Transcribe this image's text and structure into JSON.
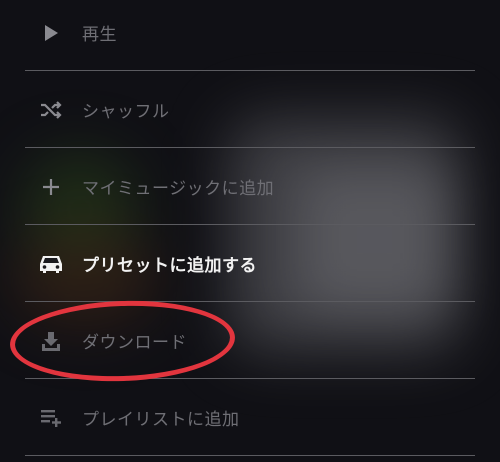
{
  "menu": {
    "items": [
      {
        "label": "再生",
        "icon": "play-icon",
        "state": "dim"
      },
      {
        "label": "シャッフル",
        "icon": "shuffle-icon",
        "state": "dim"
      },
      {
        "label": "マイミュージックに追加",
        "icon": "plus-icon",
        "state": "dim"
      },
      {
        "label": "プリセットに追加する",
        "icon": "car-icon",
        "state": "bright"
      },
      {
        "label": "ダウンロード",
        "icon": "download-icon",
        "state": "dim"
      },
      {
        "label": "プレイリストに追加",
        "icon": "playlist-add-icon",
        "state": "dim"
      }
    ]
  },
  "colors": {
    "dim_text": "#6f6f75",
    "bright_text": "#f2f2f2",
    "highlight_circle": "#e2353e"
  }
}
